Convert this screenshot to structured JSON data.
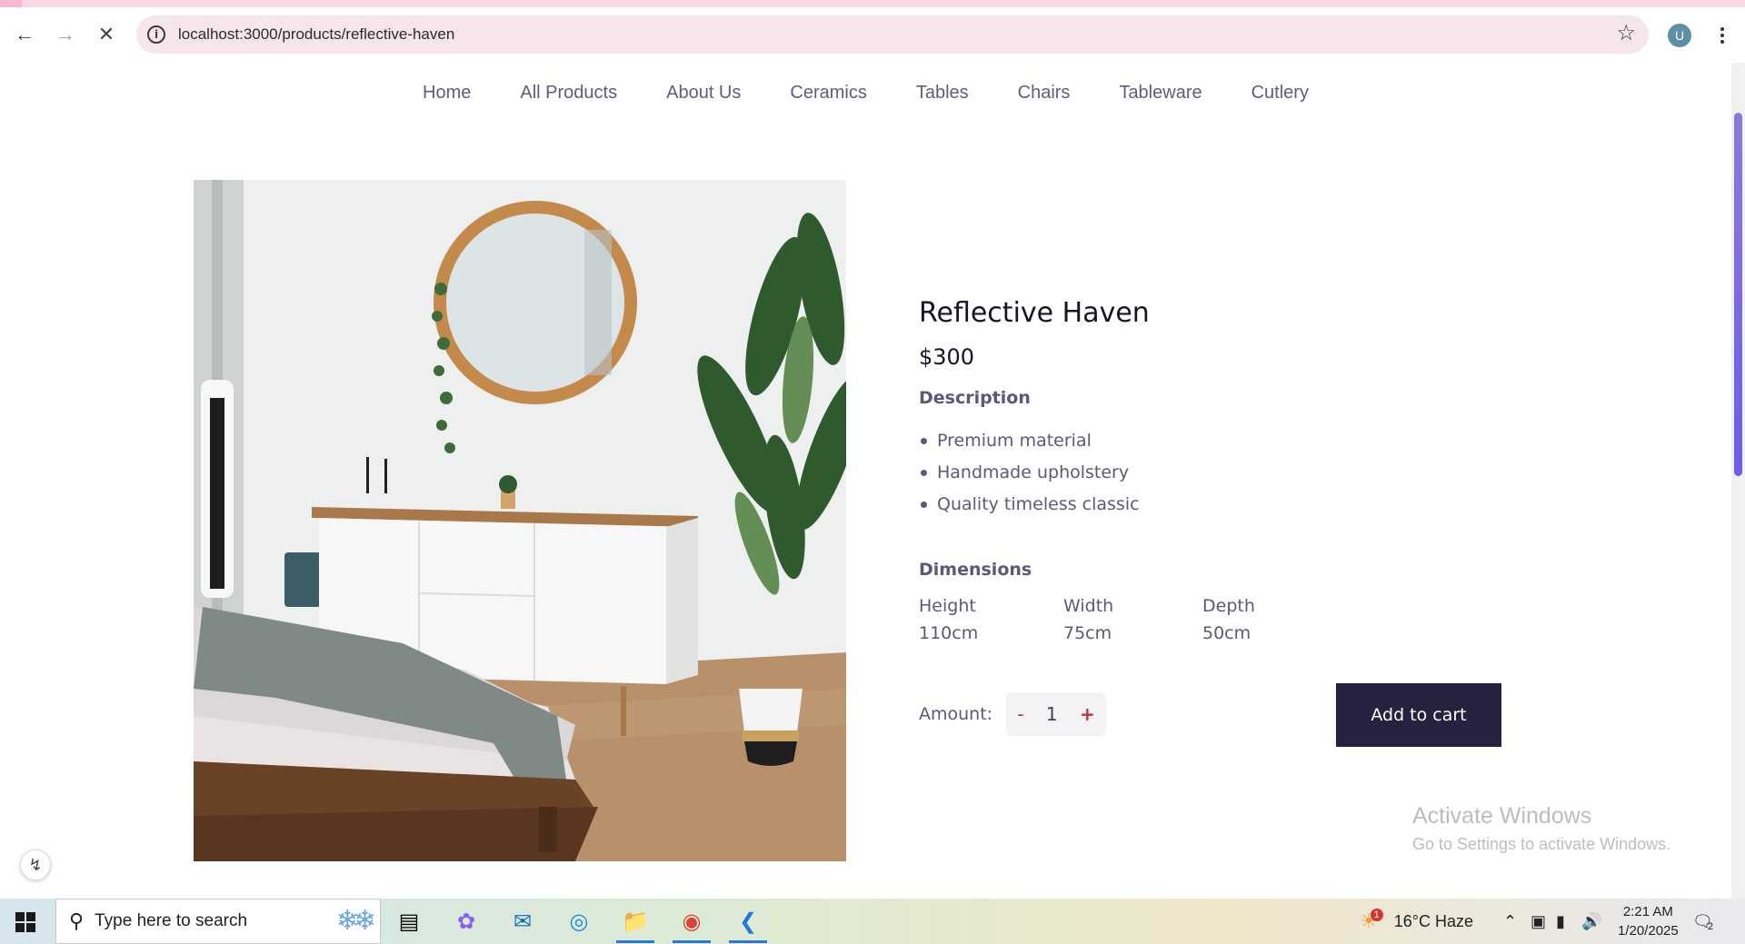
{
  "browser": {
    "url": "localhost:3000/products/reflective-haven",
    "profile_initial": "U"
  },
  "site_nav": [
    {
      "label": "Home"
    },
    {
      "label": "All Products"
    },
    {
      "label": "About Us"
    },
    {
      "label": "Ceramics"
    },
    {
      "label": "Tables"
    },
    {
      "label": "Chairs"
    },
    {
      "label": "Tableware"
    },
    {
      "label": "Cutlery"
    }
  ],
  "product": {
    "title": "Reflective Haven",
    "price": "$300",
    "description_heading": "Description",
    "features": [
      "Premium material",
      "Handmade upholstery",
      "Quality timeless classic"
    ],
    "dimensions_heading": "Dimensions",
    "dimensions": [
      {
        "label": "Height",
        "value": "110cm"
      },
      {
        "label": "Width",
        "value": "75cm"
      },
      {
        "label": "Depth",
        "value": "50cm"
      }
    ],
    "amount_label": "Amount:",
    "quantity": "1",
    "minus_label": "-",
    "plus_label": "+",
    "add_to_cart_label": "Add to cart"
  },
  "watermark": {
    "line1": "Activate Windows",
    "line2": "Go to Settings to activate Windows."
  },
  "taskbar": {
    "search_placeholder": "Type here to search",
    "weather": "16°C  Haze",
    "weather_badge": "1",
    "time": "2:21 AM",
    "date": "1/20/2025",
    "notification_count": "2"
  }
}
